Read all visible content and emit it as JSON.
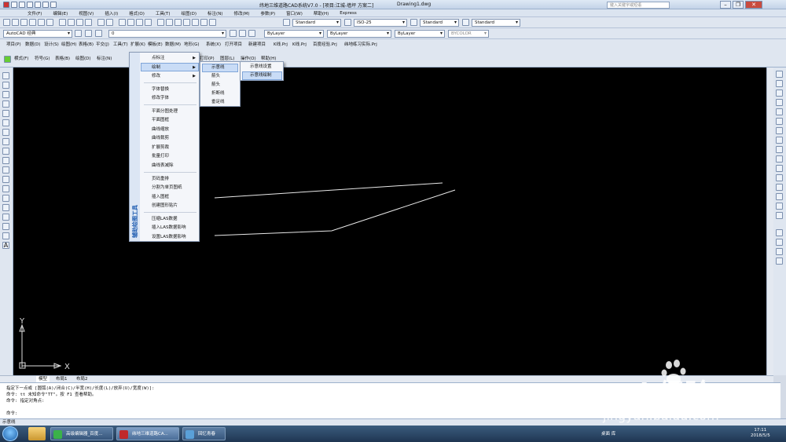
{
  "titlebar": {
    "title": "纬地三维道路CAD系统V7.0 - [项目:江城-墙坪 方案二]",
    "document": "Drawing1.dwg",
    "search_placeholder": "键入关键字或短语"
  },
  "menubar": [
    "文件(F)",
    "编辑(E)",
    "视图(V)",
    "插入(I)",
    "格式(O)",
    "工具(T)",
    "绘图(D)",
    "标注(N)",
    "修改(M)",
    "参数(P)",
    "窗口(W)",
    "帮助(H)",
    "Express"
  ],
  "styles": {
    "text_style": "Standard",
    "dim_style": "ISO-25",
    "table_style": "Standard",
    "multileader_style": "Standard"
  },
  "layers": {
    "workspace": "AutoCAD 经典",
    "layer": "0",
    "color": "ByLayer",
    "linetype": "ByLayer",
    "lineweight": "ByLayer",
    "plotstyle": "BYCOLOR"
  },
  "project_menu": [
    "项目(P)",
    "数据(D)",
    "设计(S)",
    "绘图(H)",
    "表格(B)",
    "平交(J)",
    "工具(T)",
    "扩展(K)",
    "模板(E)",
    "数据(M)",
    "地形(G)",
    "系统(X)",
    "打开项目",
    "新建项目",
    "K线.Prj",
    "K线.Prj",
    "百度经验.Prj",
    "纬地练习实际.Prj"
  ],
  "second_menu": [
    "横式(F)",
    "符号(G)",
    "表格(B)",
    "绘图(D)",
    "标注(N)",
    "打印(P)",
    "图层(L)",
    "操作(O)",
    "帮助(H)"
  ],
  "dropdown_main": {
    "side_title": "辅助绘图工具",
    "items": [
      "点标注",
      "绘制",
      "修改",
      "字体替换",
      "修改字体",
      "平面分图处理",
      "平面图框",
      "曲线缩放",
      "曲线裁剪",
      "扩展剪裁",
      "批量打印",
      "曲线表减除",
      "页码重排",
      "分割为单页图纸",
      "插入图框",
      "创建图形贴片",
      "压缩LAS数据",
      "插入LAS数据影响",
      "设置LAS数据影响"
    ]
  },
  "dropdown_draw": {
    "items": [
      "示意线",
      "箭头",
      "箭头",
      "折断线",
      "垂足线"
    ]
  },
  "dropdown_sub": {
    "items": [
      "示意线设置",
      "示意线绘制"
    ]
  },
  "axis": {
    "x": "X",
    "y": "Y"
  },
  "tabs": [
    "模型",
    "布局1",
    "布局2"
  ],
  "command_lines": [
    "指定下一点或 [圆弧(A)/闭合(C)/半宽(H)/长度(L)/放弃(U)/宽度(W)]:",
    "命令: tt 未知命令\"TT\"。按 F1 查看帮助。",
    "命令: 指定对角点:",
    "",
    "命令:"
  ],
  "status": "示意线",
  "taskbar": {
    "items": [
      "高级编辑器_百度...",
      "纬地三维道路CA...",
      "回忆青春"
    ],
    "tray_text": "桌面   库",
    "time": "17:11",
    "date": "2018/5/5"
  },
  "watermark": {
    "logo": "Bai 经验",
    "url": "jingyan.baidu.com"
  },
  "colors": {
    "canvas": "#000000",
    "accent": "#1c5bb0",
    "highlight": "#c9dcf6"
  }
}
